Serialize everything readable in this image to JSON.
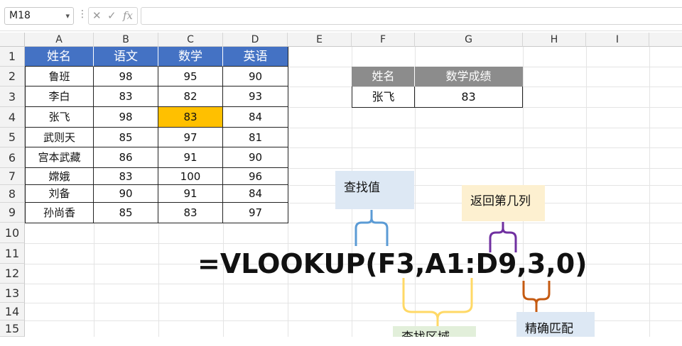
{
  "formula_bar": {
    "name_box": "M18",
    "fx_label": "fx",
    "value": ""
  },
  "columns": [
    "A",
    "B",
    "C",
    "D",
    "E",
    "F",
    "G",
    "H",
    "I"
  ],
  "rows": [
    "1",
    "2",
    "3",
    "4",
    "5",
    "6",
    "7",
    "8",
    "9",
    "10",
    "11",
    "12",
    "13",
    "14",
    "15"
  ],
  "main_table": {
    "headers": [
      "姓名",
      "语文",
      "数学",
      "英语"
    ],
    "rows": [
      [
        "鲁班",
        "98",
        "95",
        "90"
      ],
      [
        "李白",
        "83",
        "82",
        "93"
      ],
      [
        "张飞",
        "98",
        "83",
        "84"
      ],
      [
        "武则天",
        "85",
        "97",
        "81"
      ],
      [
        "宫本武藏",
        "86",
        "91",
        "90"
      ],
      [
        "嫦娥",
        "83",
        "100",
        "96"
      ],
      [
        "刘备",
        "90",
        "91",
        "84"
      ],
      [
        "孙尚香",
        "85",
        "83",
        "97"
      ]
    ],
    "highlight_color": "#ffc000",
    "header_color": "#4472c4"
  },
  "lookup_table": {
    "headers": [
      "姓名",
      "数学成绩"
    ],
    "row": [
      "张飞",
      "83"
    ],
    "header_color": "#8c8c8c"
  },
  "annotations": {
    "formula": "=VLOOKUP(F3,A1:D9,3,0)",
    "lookup_value": "查找值",
    "col_index": "返回第几列",
    "exact_match": "精确匹配",
    "range": "查找区域"
  },
  "brace_colors": {
    "lookup_value": "#5b9bd5",
    "col_index": "#7030a0",
    "exact_match": "#c55a11",
    "range": "#ffd966"
  }
}
